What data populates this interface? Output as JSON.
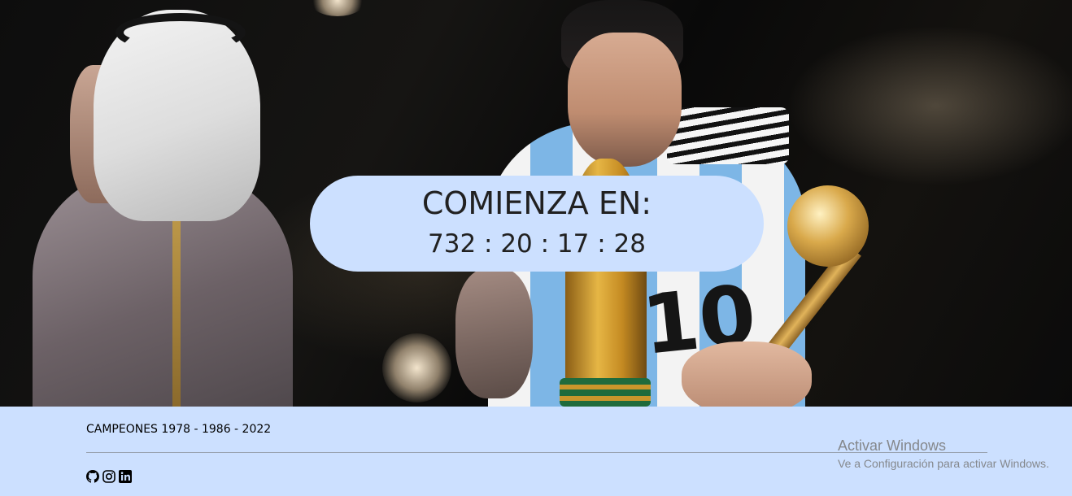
{
  "countdown": {
    "title": "COMIENZA EN:",
    "timer": "732 : 20 : 17 : 28"
  },
  "footer": {
    "text": "CAMPEONES 1978 - 1986 - 2022",
    "social_icons": [
      "github-icon",
      "instagram-icon",
      "linkedin-icon"
    ],
    "background_color": "#cce0ff"
  },
  "hero": {
    "number_on_jersey": "10"
  },
  "windows_watermark": {
    "title": "Activar Windows",
    "subtitle": "Ve a Configuración para activar Windows."
  },
  "colors": {
    "countdown_background": "#cce0ff",
    "countdown_text": "#212121"
  }
}
